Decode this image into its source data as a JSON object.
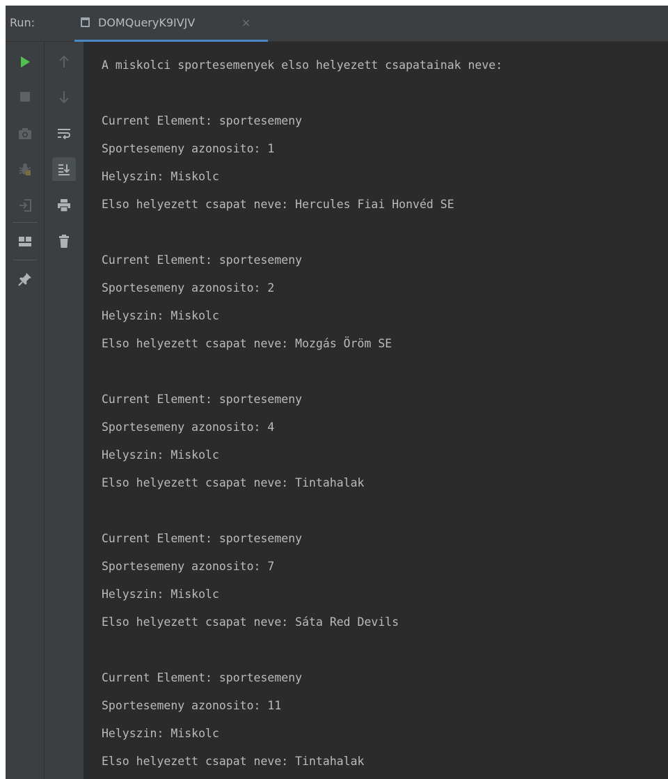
{
  "header": {
    "run_label": "Run:",
    "tab_title": "DOMQueryK9IVJV",
    "tab_close": "×"
  },
  "toolbar": {
    "left": [
      "run-icon",
      "stop-icon",
      "camera-icon",
      "bug-icon",
      "exit-icon",
      "layout-icon",
      "pin-icon"
    ],
    "right": [
      "up-arrow-icon",
      "down-arrow-icon",
      "soft-wrap-icon",
      "scroll-to-end-icon",
      "print-icon",
      "trash-icon"
    ]
  },
  "colors": {
    "run": "#4fc24f",
    "active_button": "#4b5052",
    "tab_underline": "#4a88c7"
  },
  "console": {
    "lines": [
      "A miskolci sportesemenyek elso helyezett csapatainak neve:",
      "",
      "Current Element: sportesemeny",
      "Sportesemeny azonosito: 1",
      "Helyszin: Miskolc",
      "Elso helyezett csapat neve: Hercules Fiai Honvéd SE",
      "",
      "Current Element: sportesemeny",
      "Sportesemeny azonosito: 2",
      "Helyszin: Miskolc",
      "Elso helyezett csapat neve: Mozgás Öröm SE",
      "",
      "Current Element: sportesemeny",
      "Sportesemeny azonosito: 4",
      "Helyszin: Miskolc",
      "Elso helyezett csapat neve: Tintahalak",
      "",
      "Current Element: sportesemeny",
      "Sportesemeny azonosito: 7",
      "Helyszin: Miskolc",
      "Elso helyezett csapat neve: Sáta Red Devils",
      "",
      "Current Element: sportesemeny",
      "Sportesemeny azonosito: 11",
      "Helyszin: Miskolc",
      "Elso helyezett csapat neve: Tintahalak"
    ]
  }
}
